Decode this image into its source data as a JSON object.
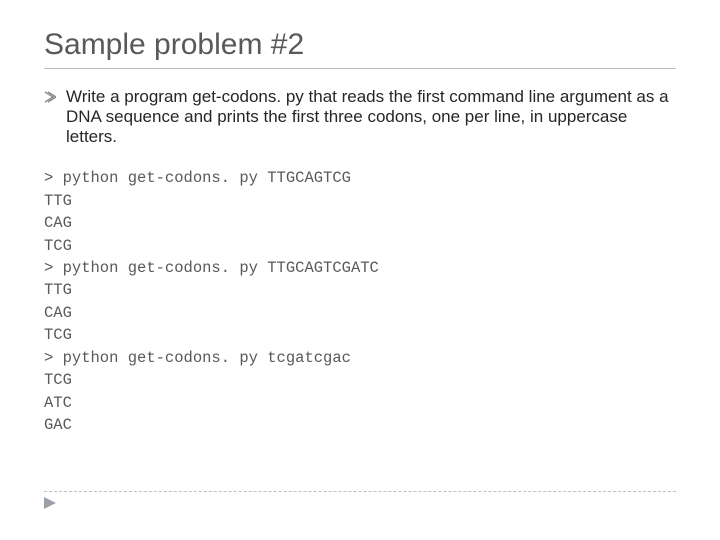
{
  "title": "Sample problem #2",
  "body": "Write a program get-codons. py that reads the first command line argument as a DNA sequence and prints the first three codons, one per line, in uppercase letters.",
  "code": {
    "l01": "> python get-codons. py TTGCAGTCG",
    "l02": "TTG",
    "l03": "CAG",
    "l04": "TCG",
    "l05": "> python get-codons. py TTGCAGTCGATC",
    "l06": "TTG",
    "l07": "CAG",
    "l08": "TCG",
    "l09": "> python get-codons. py tcgatcgac",
    "l10": "TCG",
    "l11": "ATC",
    "l12": "GAC"
  }
}
